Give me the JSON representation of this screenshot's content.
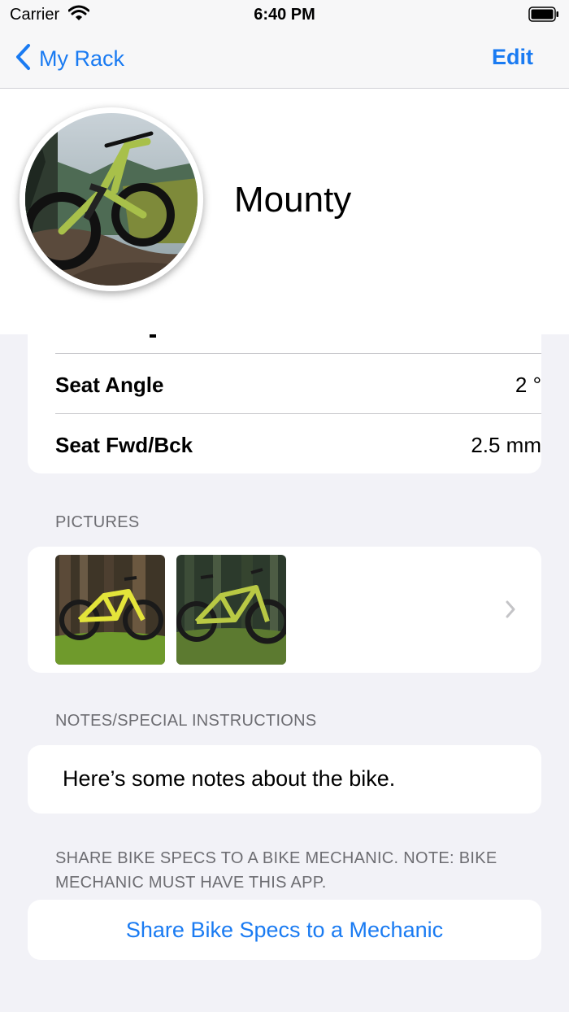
{
  "status_bar": {
    "carrier": "Carrier",
    "time": "6:40 PM"
  },
  "nav": {
    "back_label": "My Rack",
    "edit_label": "Edit"
  },
  "bike": {
    "name": "Mounty"
  },
  "specs": [
    {
      "label": "Seat Angle",
      "value": "2  °"
    },
    {
      "label": "Seat Fwd/Bck",
      "value": "2.5  mm"
    }
  ],
  "pictures": {
    "header": "PICTURES",
    "count": 2
  },
  "notes": {
    "header": "NOTES/SPECIAL INSTRUCTIONS",
    "text": "Here’s some notes about the bike."
  },
  "share": {
    "footer": "SHARE BIKE SPECS TO A BIKE MECHANIC. NOTE: BIKE MECHANIC MUST HAVE THIS APP.",
    "button_label": "Share Bike Specs to a Mechanic"
  },
  "colors": {
    "accent": "#1a7bf2",
    "background": "#f2f2f7",
    "secondary_text": "#6d6d72"
  },
  "icons": [
    "wifi-icon",
    "battery-icon",
    "chevron-left-icon",
    "chevron-right-icon"
  ]
}
